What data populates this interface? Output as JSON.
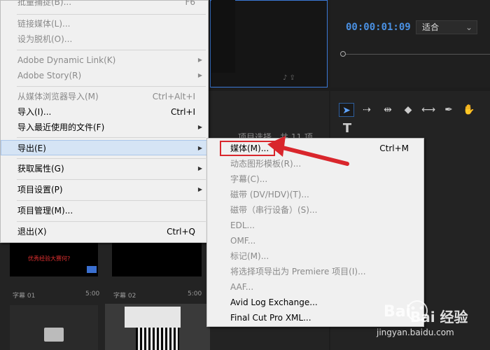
{
  "monitor": {
    "timecode": "00:00:01:09",
    "fit_value": "适合"
  },
  "project": {
    "header_text": "项目选择，共 11 项"
  },
  "thumbnails": [
    {
      "title_text": "优秀经验大赛何?",
      "label": "字幕 01",
      "duration": "5:00"
    },
    {
      "label": "字幕 02",
      "duration": "5:00"
    }
  ],
  "main_menu": {
    "items": [
      {
        "label": "批量捕捉(B)...",
        "shortcut": "F6",
        "disabled": true
      },
      {
        "label": "链接媒体(L)...",
        "shortcut": "",
        "disabled": true
      },
      {
        "label": "设为脱机(O)...",
        "shortcut": "",
        "disabled": true
      },
      {
        "label": "Adobe Dynamic Link(K)",
        "shortcut": "",
        "disabled": true,
        "submenu": true
      },
      {
        "label": "Adobe Story(R)",
        "shortcut": "",
        "disabled": true,
        "submenu": true
      },
      {
        "label": "从媒体浏览器导入(M)",
        "shortcut": "Ctrl+Alt+I",
        "disabled": true
      },
      {
        "label": "导入(I)...",
        "shortcut": "Ctrl+I",
        "disabled": false
      },
      {
        "label": "导入最近使用的文件(F)",
        "shortcut": "",
        "disabled": false,
        "submenu": true
      },
      {
        "label": "导出(E)",
        "shortcut": "",
        "disabled": false,
        "submenu": true,
        "highlighted": true
      },
      {
        "label": "获取属性(G)",
        "shortcut": "",
        "disabled": false,
        "submenu": true
      },
      {
        "label": "项目设置(P)",
        "shortcut": "",
        "disabled": false,
        "submenu": true
      },
      {
        "label": "项目管理(M)...",
        "shortcut": "",
        "disabled": false
      },
      {
        "label": "退出(X)",
        "shortcut": "Ctrl+Q",
        "disabled": false
      }
    ]
  },
  "export_menu": {
    "items": [
      {
        "label": "媒体(M)...",
        "shortcut": "Ctrl+M",
        "disabled": false,
        "highlighted": true
      },
      {
        "label": "动态图形模板(R)...",
        "shortcut": "",
        "disabled": true
      },
      {
        "label": "字幕(C)...",
        "shortcut": "",
        "disabled": true
      },
      {
        "label": "磁带 (DV/HDV)(T)...",
        "shortcut": "",
        "disabled": true
      },
      {
        "label": "磁带（串行设备）(S)...",
        "shortcut": "",
        "disabled": true
      },
      {
        "label": "EDL...",
        "shortcut": "",
        "disabled": true
      },
      {
        "label": "OMF...",
        "shortcut": "",
        "disabled": true
      },
      {
        "label": "标记(M)...",
        "shortcut": "",
        "disabled": true
      },
      {
        "label": "将选择项导出为 Premiere 项目(I)...",
        "shortcut": "",
        "disabled": true
      },
      {
        "label": "AAF...",
        "shortcut": "",
        "disabled": true
      },
      {
        "label": "Avid Log Exchange...",
        "shortcut": "",
        "disabled": false
      },
      {
        "label": "Final Cut Pro XML...",
        "shortcut": "",
        "disabled": false
      }
    ]
  },
  "watermark": {
    "brand": "Bai 经验",
    "url": "jingyan.baidu.com"
  },
  "colors": {
    "accent": "#4a90e2",
    "annotation_red": "#d9262c",
    "menu_bg": "#f0f0f0",
    "menu_highlight": "#d5e4f5"
  }
}
